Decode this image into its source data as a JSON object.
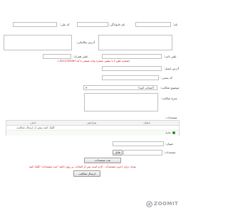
{
  "form": {
    "first_name_label": "نام:",
    "last_name_label": "نام خانوادگی:",
    "national_code_label": "کد ملی:",
    "address_label": "آدرس:",
    "postal_address_label": "آدرس مکاتباتی:",
    "phone_label": "تلفن ثابت:",
    "phone_hint": "(شماره تلفن ۸ یا بیشتر، شماره واحد صنعتی با کد-0211234567-(",
    "mobile_label": "تلفن همراه:",
    "email_label": "آدرس ایمیل:",
    "postal_code_label": "کد پستی:",
    "subject_label": "موضوع شکایت:",
    "subject_selected": "(انتخاب کنید)",
    "complaint_desc_label": "شرح شکایت:",
    "documents_label": "مستندات:"
  },
  "table": {
    "headers": [
      "عنوان",
      "ویرایش",
      "حذف"
    ],
    "rows": [
      {
        "title": "",
        "edit": "",
        "delete": "کلیک کنید پیش از ارسال شکایت"
      }
    ],
    "selected_option": "جدید"
  },
  "upload": {
    "title_label": "عنوان:",
    "file_label": "مستندات:",
    "choose_button": "فایل",
    "add_button": "ثبت مستندات"
  },
  "footer": {
    "warning": "توجه: برای ذخیره مستندات ، لازم است پس از انتخاب، بر روی دکمه \"ثبت مستندات\" کلیک کنید",
    "submit_button": "ارسال شکایت"
  },
  "watermark": {
    "text": "ZOOMIT"
  },
  "colors": {
    "warning_red": "#d00000",
    "border_gray": "#bfbfbf",
    "radio_green": "#2e8b2e"
  }
}
